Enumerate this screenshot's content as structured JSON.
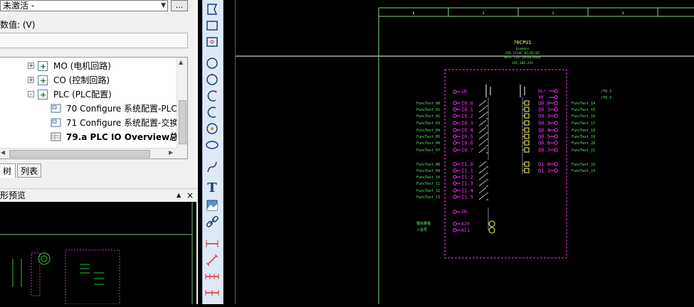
{
  "properties": {
    "dropdown_value": "未激活 -",
    "ellipsis_label": "...",
    "value_label": "数值: (V)",
    "value_field": ""
  },
  "tree": {
    "items": [
      {
        "expander": "+",
        "label": "MO (电机回路)"
      },
      {
        "expander": "+",
        "label": "CO (控制回路)"
      },
      {
        "expander": "-",
        "label": "PLC (PLC配置)"
      },
      {
        "label": "70 Configure 系统配置-PLC"
      },
      {
        "label": "71 Configure 系统配置-交换"
      },
      {
        "label": "79.a PLC IO Overview总览"
      }
    ]
  },
  "tabs": [
    "树",
    "列表"
  ],
  "preview": {
    "title": "形预览",
    "pin": "▲",
    "close": "×"
  },
  "toolbar": {
    "tools": [
      "polygon-icon",
      "rectangle-icon",
      "rounded-rect-icon",
      "circle-icon",
      "circle-alt-icon",
      "arc-icon",
      "arc-alt-icon",
      "circle-3pt-icon",
      "ellipse-icon",
      "spline-icon",
      "text-tool-icon",
      "image-icon",
      "link-icon",
      "dimension-h-icon",
      "dimension-diag-icon",
      "dimension-chain-icon",
      "dimension-base-icon"
    ],
    "text_glyph": "T"
  },
  "drawing": {
    "columns": [
      "0",
      "1",
      "2",
      "3"
    ],
    "device": {
      "tag": "?0CPU1",
      "maker": "Siemens",
      "model": "CPU 1214C DC/DC/DC",
      "order": "6ES7 214-1AG40-0XB0",
      "io": "14I,10O,2AI"
    },
    "left_labels": [
      "FuncText_00",
      "FuncText_01",
      "FuncText_02",
      "FuncText_03",
      "FuncText_04",
      "FuncText_05",
      "FuncText_06",
      "FuncText_07",
      "FuncText_08",
      "FuncText_09",
      "FuncText_10",
      "FuncText_11",
      "FuncText_12",
      "FuncText_13"
    ],
    "inputs": [
      "I0.0",
      "I0.1",
      "I0.2",
      "I0.3",
      "I0.4",
      "I0.5",
      "I0.6",
      "I0.7",
      "I1.0",
      "I1.1",
      "I1.2",
      "I1.3",
      "I1.4",
      "I1.5"
    ],
    "outputs": [
      "Q0.0",
      "Q0.1",
      "Q0.2",
      "Q0.3",
      "Q0.4",
      "Q0.5",
      "Q0.6",
      "Q0.7",
      "Q1.0",
      "Q1.1"
    ],
    "right_labels": [
      "FuncText_14",
      "FuncText_15",
      "FuncText_16",
      "FuncText_17",
      "FuncText_18",
      "FuncText_19",
      "FuncText_20",
      "FuncText_21",
      "FuncText_22",
      "FuncText_23"
    ],
    "supply": {
      "m1": "1M",
      "l_plus": "DL+",
      "m": "3M",
      "m2": "2M",
      "ref1": "/T0.3",
      "ref2": "/T0.3"
    },
    "analog": {
      "label1": "模拟量输",
      "label2": "入信号",
      "ai0": "AI0",
      "ai1": "AI1"
    }
  }
}
